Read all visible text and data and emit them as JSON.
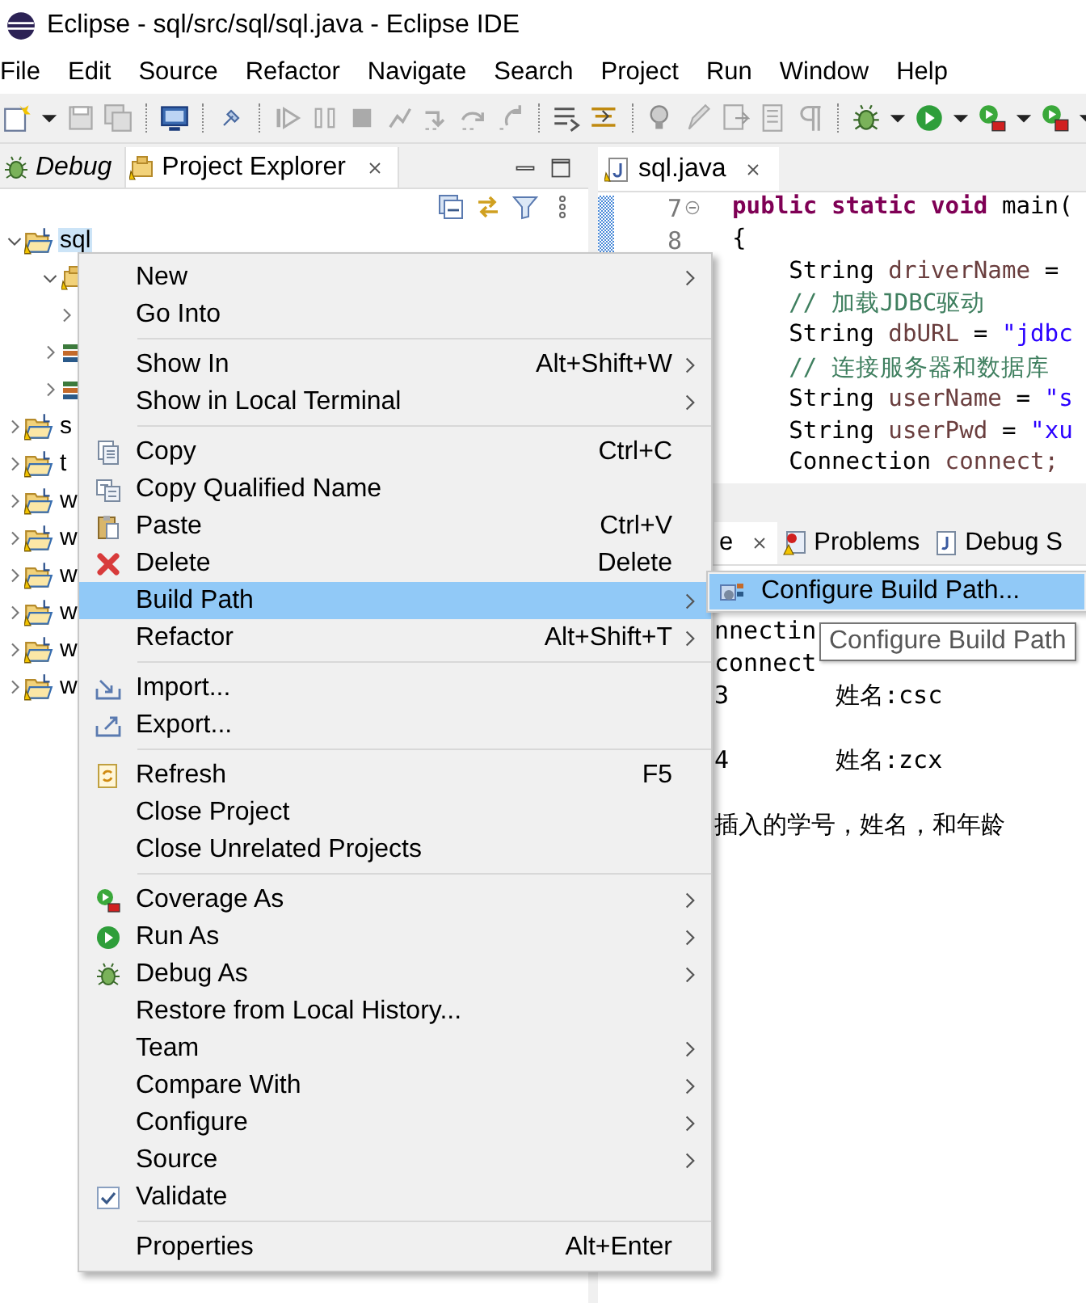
{
  "window": {
    "title": "Eclipse - sql/src/sql/sql.java - Eclipse IDE"
  },
  "menu_bar": [
    "File",
    "Edit",
    "Source",
    "Refactor",
    "Navigate",
    "Search",
    "Project",
    "Run",
    "Window",
    "Help"
  ],
  "left_panel": {
    "tabs": [
      {
        "label": "Debug",
        "selected": false
      },
      {
        "label": "Project Explorer",
        "selected": true
      }
    ],
    "tree": [
      {
        "label": "sql",
        "kind": "project",
        "expanded": true,
        "selected": true,
        "children": [
          {
            "kind": "package",
            "expanded": true,
            "selected": false,
            "children": [
              {
                "expanded": false,
                "selected": false
              }
            ]
          },
          {
            "kind": "library",
            "expanded": false,
            "selected": false
          },
          {
            "kind": "library",
            "expanded": false,
            "selected": false
          }
        ]
      },
      {
        "label": "s",
        "kind": "project",
        "expanded": false,
        "selected": false
      },
      {
        "label": "t",
        "kind": "project",
        "expanded": false,
        "selected": false
      },
      {
        "label": "w",
        "kind": "project",
        "expanded": false,
        "selected": false
      },
      {
        "label": "w",
        "kind": "project",
        "expanded": false,
        "selected": false
      },
      {
        "label": "w",
        "kind": "project",
        "expanded": false,
        "selected": false
      },
      {
        "label": "w",
        "kind": "project",
        "expanded": false,
        "selected": false
      },
      {
        "label": "w",
        "kind": "project",
        "expanded": false,
        "selected": false
      },
      {
        "label": "w",
        "kind": "project",
        "expanded": false,
        "selected": false
      }
    ]
  },
  "editor": {
    "tabs": [
      {
        "label": "sql.java",
        "selected": true
      }
    ],
    "gutter": [
      {
        "number": "7",
        "fold": true
      },
      {
        "number": "8",
        "fold": false
      }
    ],
    "lines": [
      [
        {
          "text": "public static void ",
          "kind": "keyword"
        },
        {
          "text": "main(",
          "kind": "plain"
        }
      ],
      [
        {
          "text": "{",
          "kind": "plain"
        }
      ],
      [
        {
          "text": "    String ",
          "kind": "plain"
        },
        {
          "text": "driverName",
          "kind": "variable"
        },
        {
          "text": " =",
          "kind": "plain"
        }
      ],
      [
        {
          "text": "    // 加载JDBC驱动",
          "kind": "comment"
        }
      ],
      [
        {
          "text": "    String ",
          "kind": "plain"
        },
        {
          "text": "dbURL",
          "kind": "variable"
        },
        {
          "text": " = ",
          "kind": "plain"
        },
        {
          "text": "\"jdbc",
          "kind": "string"
        }
      ],
      [
        {
          "text": "    // 连接服务器和数据库",
          "kind": "comment"
        }
      ],
      [
        {
          "text": "    String ",
          "kind": "plain"
        },
        {
          "text": "userName",
          "kind": "variable"
        },
        {
          "text": " = ",
          "kind": "plain"
        },
        {
          "text": "\"s",
          "kind": "string"
        }
      ],
      [
        {
          "text": "    String ",
          "kind": "plain"
        },
        {
          "text": "userPwd",
          "kind": "variable"
        },
        {
          "text": " = ",
          "kind": "plain"
        },
        {
          "text": "\"xu",
          "kind": "string"
        }
      ],
      [
        {
          "text": "    Connection ",
          "kind": "plain"
        },
        {
          "text": "connect;",
          "kind": "variable"
        }
      ]
    ]
  },
  "console": {
    "tabs": [
      {
        "label": "e",
        "selected": true,
        "closable": true
      },
      {
        "label": "Problems",
        "selected": false,
        "closable": false
      },
      {
        "label": "Debug S",
        "selected": false,
        "closable": false
      }
    ],
    "lines": [
      {
        "text": "nnectin"
      },
      {
        "text": "connect"
      },
      {
        "number": "3",
        "text": "姓名:csc"
      },
      {
        "number": "4",
        "text": "姓名:zcx"
      },
      {
        "text": "插入的学号，姓名，和年龄"
      }
    ]
  },
  "context_menu": {
    "items": [
      {
        "kind": "item",
        "label": "New",
        "submenu": true,
        "selected": false
      },
      {
        "kind": "item",
        "label": "Go Into",
        "submenu": false,
        "selected": false
      },
      {
        "kind": "separator"
      },
      {
        "kind": "item",
        "label": "Show In",
        "shortcut": "Alt+Shift+W",
        "submenu": true,
        "selected": false
      },
      {
        "kind": "item",
        "label": "Show in Local Terminal",
        "submenu": true,
        "selected": false
      },
      {
        "kind": "separator"
      },
      {
        "kind": "copy",
        "label": "Copy",
        "shortcut": "Ctrl+C",
        "submenu": false,
        "selected": false
      },
      {
        "kind": "copy2",
        "label": "Copy Qualified Name",
        "submenu": false,
        "selected": false
      },
      {
        "kind": "paste",
        "label": "Paste",
        "shortcut": "Ctrl+V",
        "submenu": false,
        "selected": false
      },
      {
        "kind": "delete",
        "label": "Delete",
        "shortcut": "Delete",
        "submenu": false,
        "selected": false
      },
      {
        "kind": "item",
        "label": "Build Path",
        "submenu": true,
        "selected": true
      },
      {
        "kind": "item",
        "label": "Refactor",
        "shortcut": "Alt+Shift+T",
        "submenu": true,
        "selected": false
      },
      {
        "kind": "separator"
      },
      {
        "kind": "import",
        "label": "Import...",
        "submenu": false,
        "selected": false
      },
      {
        "kind": "export",
        "label": "Export...",
        "submenu": false,
        "selected": false
      },
      {
        "kind": "separator"
      },
      {
        "kind": "refresh",
        "label": "Refresh",
        "shortcut": "F5",
        "submenu": false,
        "selected": false
      },
      {
        "kind": "item",
        "label": "Close Project",
        "submenu": false,
        "selected": false
      },
      {
        "kind": "item",
        "label": "Close Unrelated Projects",
        "submenu": false,
        "selected": false
      },
      {
        "kind": "separator"
      },
      {
        "kind": "coverage",
        "label": "Coverage As",
        "submenu": true,
        "selected": false
      },
      {
        "kind": "run",
        "label": "Run As",
        "submenu": true,
        "selected": false
      },
      {
        "kind": "bug",
        "label": "Debug As",
        "submenu": true,
        "selected": false
      },
      {
        "kind": "item",
        "label": "Restore from Local History...",
        "submenu": false,
        "selected": false
      },
      {
        "kind": "item",
        "label": "Team",
        "submenu": true,
        "selected": false
      },
      {
        "kind": "item",
        "label": "Compare With",
        "submenu": true,
        "selected": false
      },
      {
        "kind": "item",
        "label": "Configure",
        "submenu": true,
        "selected": false
      },
      {
        "kind": "item",
        "label": "Source",
        "submenu": true,
        "selected": false
      },
      {
        "kind": "check",
        "label": "Validate",
        "checked": true,
        "selected": false
      },
      {
        "kind": "separator"
      },
      {
        "kind": "item",
        "label": "Properties",
        "shortcut": "Alt+Enter",
        "submenu": false,
        "selected": false
      }
    ]
  },
  "submenu": {
    "items": [
      {
        "label": "Configure Build Path...",
        "selected": true
      }
    ]
  },
  "tooltip": {
    "text": "Configure Build Path"
  }
}
